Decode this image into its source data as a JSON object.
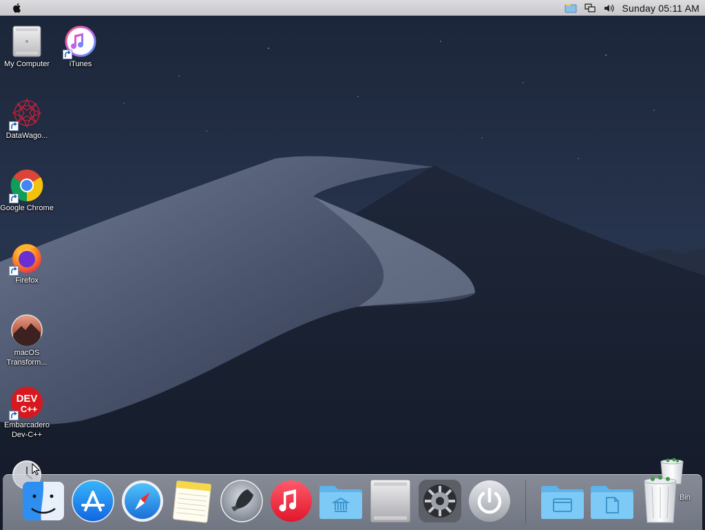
{
  "menubar": {
    "clock_text": "Sunday 05:11 AM"
  },
  "desktop": {
    "icons": [
      {
        "label": "My Computer"
      },
      {
        "label": "iTunes"
      },
      {
        "label": "DataWago..."
      },
      {
        "label": "Google Chrome"
      },
      {
        "label": "Firefox"
      },
      {
        "label": "macOS Transform..."
      },
      {
        "label": "Embarcadero Dev-C++"
      }
    ]
  },
  "dock": {
    "items": [
      "finder-icon",
      "app-store-icon",
      "safari-icon",
      "notes-icon",
      "launchpad-icon",
      "music-icon",
      "applications-folder-icon",
      "my-computer-icon",
      "system-preferences-icon",
      "power-icon",
      "documents-folder-icon",
      "files-folder-icon",
      "recycle-bin-icon"
    ],
    "trash_label": "Bin"
  }
}
